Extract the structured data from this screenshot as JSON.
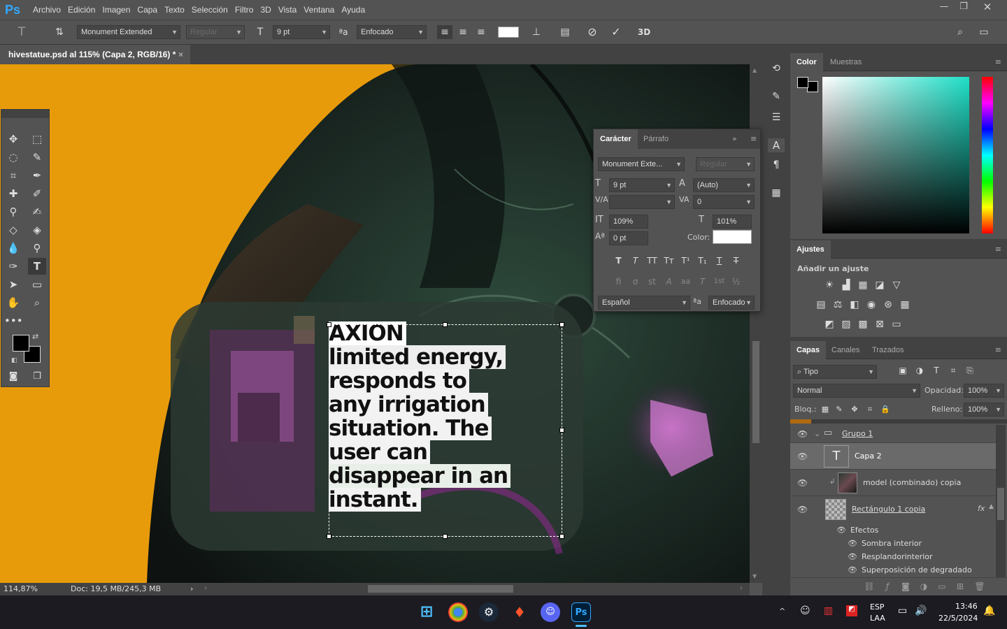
{
  "menu": {
    "items": [
      "Archivo",
      "Edición",
      "Imagen",
      "Capa",
      "Texto",
      "Selección",
      "Filtro",
      "3D",
      "Vista",
      "Ventana",
      "Ayuda"
    ]
  },
  "options": {
    "font_family": "Monument Extended",
    "font_style": "Regular",
    "font_size": "9 pt",
    "aa_label": "a",
    "antialias": "Enfocado"
  },
  "document": {
    "tab_title": "hivestatue.psd al 115% (Capa 2, RGB/16) *",
    "close": "×"
  },
  "artwork": {
    "text_lines": [
      "AXION",
      "limited energy,",
      "responds to",
      "any irrigation",
      "situation. The",
      "user can",
      "disappear in an",
      "instant."
    ]
  },
  "status": {
    "zoom": "114,87%",
    "doc": "Doc: 19,5 MB/245,3 MB",
    "arrow": "›"
  },
  "character_panel": {
    "tab_active": "Carácter",
    "tab_inactive": "Párrafo",
    "font_family": "Monument Exte...",
    "font_style": "Regular",
    "size": "9 pt",
    "leading": "(Auto)",
    "kerning": "",
    "tracking": "0",
    "vscale": "109%",
    "hscale": "101%",
    "baseline": "0 pt",
    "color_label": "Color:",
    "language": "Español",
    "aa_label": "a",
    "antialias": "Enfocado",
    "type_buttons": [
      "T",
      "T",
      "TT",
      "Tт",
      "T¹",
      "T₁",
      "T",
      "T"
    ],
    "ot_buttons": [
      "fi",
      "ơ",
      "st",
      "A",
      "aa",
      "T",
      "1st",
      "½"
    ]
  },
  "color_panel": {
    "tab_active": "Color",
    "tab_inactive": "Muestras"
  },
  "adjustments_panel": {
    "title": "Ajustes",
    "subtitle": "Añadir un ajuste"
  },
  "layers_panel": {
    "tabs": [
      "Capas",
      "Canales",
      "Trazados"
    ],
    "filter": "Tipo",
    "blend_mode": "Normal",
    "opacity_label": "Opacidad:",
    "opacity": "100%",
    "lock_label": "Bloq.:",
    "fill_label": "Relleno:",
    "fill": "100%",
    "layers": [
      {
        "name": "Grupo 1"
      },
      {
        "name": "Capa 2"
      },
      {
        "name": "model (combinado) copia"
      },
      {
        "name": "Rectángulo 1 copia",
        "fx": "fx"
      }
    ],
    "effects_label": "Efectos",
    "effects": [
      "Sombra interior",
      "Resplandorinterior",
      "Superposición de degradado"
    ]
  },
  "taskbar": {
    "lang": "ESP",
    "lang2": "LAA",
    "time": "13:46",
    "date": "22/5/2024"
  },
  "colors": {
    "accent": "#31a8ff",
    "canvas_orange": "#e89b0a",
    "panel": "#535353",
    "dark": "#424242"
  }
}
